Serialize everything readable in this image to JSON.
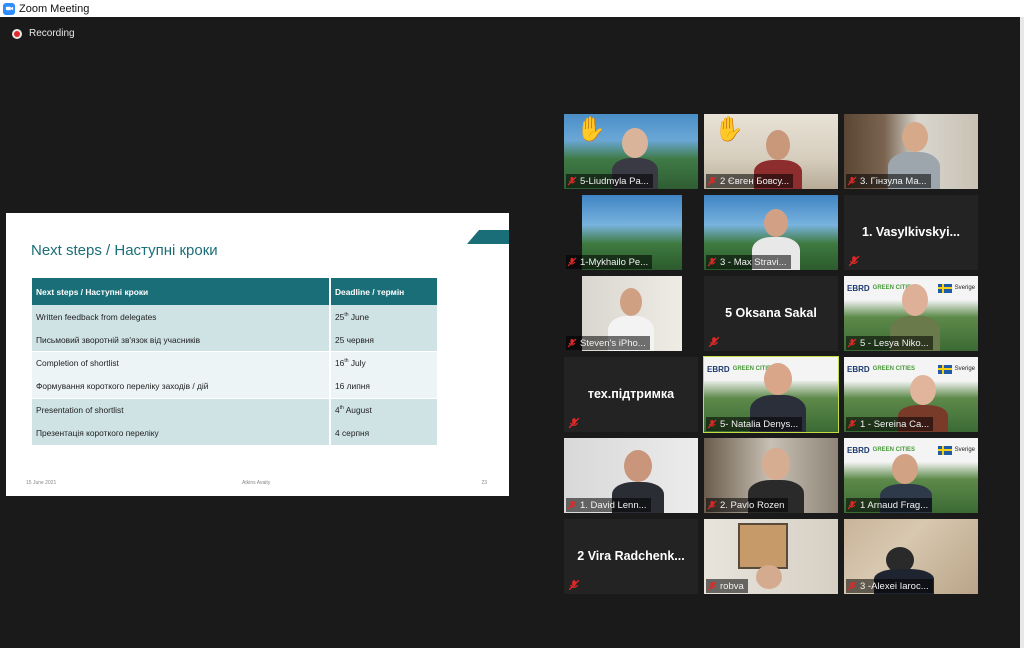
{
  "window": {
    "title": "Zoom Meeting",
    "icon": "zoom-camera-icon"
  },
  "recording": {
    "label": "Recording",
    "icon": "recording-dot-icon"
  },
  "slide": {
    "title": "Next steps / Наступні кроки",
    "table": {
      "headers": [
        "Next steps / Наступні кроки",
        "Deadline / термін"
      ],
      "rows": [
        {
          "step": "Written feedback from delegates",
          "deadline_num": "25",
          "deadline_sup": "th",
          "deadline_rest": " June"
        },
        {
          "step": "Письмовий зворотній зв'язок від учасників",
          "deadline_num": "25 червня",
          "deadline_sup": "",
          "deadline_rest": ""
        },
        {
          "step": "Completion of shortlist",
          "deadline_num": "16",
          "deadline_sup": "th",
          "deadline_rest": " July"
        },
        {
          "step": "Формування короткого переліку заходів / дій",
          "deadline_num": "16 липня",
          "deadline_sup": "",
          "deadline_rest": ""
        },
        {
          "step": "Presentation of shortlist",
          "deadline_num": "4",
          "deadline_sup": "th",
          "deadline_rest": " August"
        },
        {
          "step": "Презентація короткого переліку",
          "deadline_num": "4 серпня",
          "deadline_sup": "",
          "deadline_rest": ""
        }
      ]
    },
    "footer": {
      "date": "15 June 2021",
      "org": "Atkins Avaity",
      "page": "23"
    }
  },
  "participants": [
    {
      "name": "5-Liudmyla Pa...",
      "muted": true,
      "hand_raised": true
    },
    {
      "name": "2 Євген Бовсу...",
      "muted": true,
      "hand_raised": true
    },
    {
      "name": "3. Гінзула Ма...",
      "muted": true,
      "hand_raised": false
    },
    {
      "name": "1-Mykhailo Pe...",
      "muted": true,
      "hand_raised": false
    },
    {
      "name": "3 - Max Stravi...",
      "muted": true,
      "hand_raised": false
    },
    {
      "name": "1.  Vasylkivskyi...",
      "muted": true,
      "video_off": true
    },
    {
      "name": "Steven's iPho...",
      "muted": true,
      "hand_raised": false
    },
    {
      "name": "5 Oksana Sakal",
      "muted": true,
      "video_off": true
    },
    {
      "name": "5 - Lesya Niko...",
      "muted": true,
      "hand_raised": false
    },
    {
      "name": "тех.підтримка",
      "muted": true,
      "video_off": true
    },
    {
      "name": "5- Natalia Denys...",
      "muted": true,
      "active_speaker": true
    },
    {
      "name": "1 - Sereina Ca...",
      "muted": true,
      "hand_raised": false
    },
    {
      "name": "1. David Lenn...",
      "muted": true,
      "hand_raised": false
    },
    {
      "name": "2. Pavlo Rozen",
      "muted": true,
      "hand_raised": false
    },
    {
      "name": "1 Arnaud Frag...",
      "muted": true,
      "hand_raised": false
    },
    {
      "name": "2 Vira  Radchenk...",
      "muted": true,
      "video_off": true
    },
    {
      "name": "robva",
      "muted": true,
      "hand_raised": false
    },
    {
      "name": "3 -Alexei Iaroc...",
      "muted": true,
      "hand_raised": false
    }
  ],
  "virtual_backgrounds": {
    "ebrd_logo": "EBRD",
    "green_cities": "GREEN CITIES",
    "sverige": "Sverige"
  },
  "colors": {
    "accent": "#1a6e78",
    "active_speaker": "#c4dd45",
    "mute_icon": "#e02828"
  }
}
